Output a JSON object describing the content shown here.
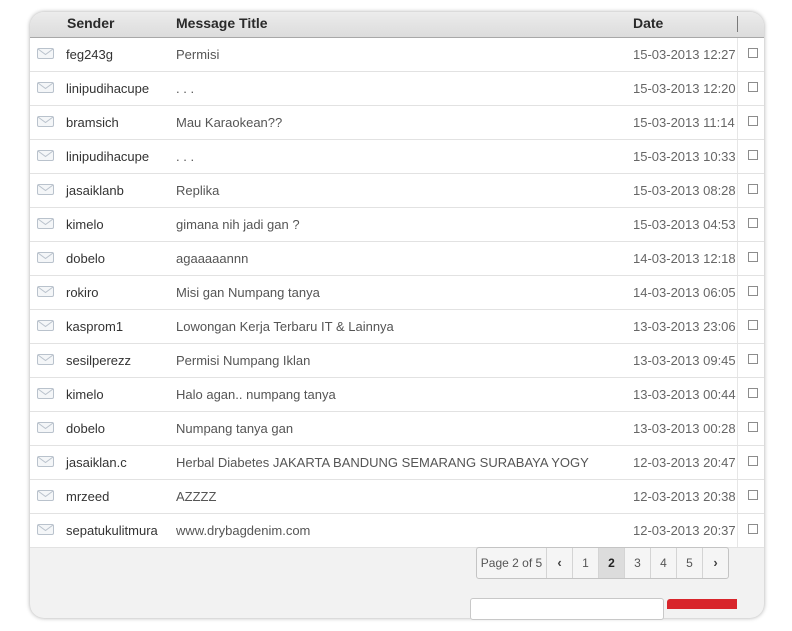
{
  "columns": {
    "sender": "Sender",
    "title": "Message Title",
    "date": "Date"
  },
  "messages": [
    {
      "sender": "feg243g",
      "title": "Permisi",
      "date": "15-03-2013 12:27"
    },
    {
      "sender": "linipudihacupe",
      "title": ". . .",
      "date": "15-03-2013 12:20"
    },
    {
      "sender": "bramsich",
      "title": "Mau Karaokean??",
      "date": "15-03-2013 11:14"
    },
    {
      "sender": "linipudihacupe",
      "title": ". . .",
      "date": "15-03-2013 10:33"
    },
    {
      "sender": "jasaiklanb",
      "title": "Replika",
      "date": "15-03-2013 08:28"
    },
    {
      "sender": "kimelo",
      "title": "gimana nih jadi gan ?",
      "date": "15-03-2013 04:53"
    },
    {
      "sender": "dobelo",
      "title": "agaaaaannn",
      "date": "14-03-2013 12:18"
    },
    {
      "sender": "rokiro",
      "title": "Misi gan Numpang tanya",
      "date": "14-03-2013 06:05"
    },
    {
      "sender": "kasprom1",
      "title": "Lowongan Kerja Terbaru IT & Lainnya",
      "date": "13-03-2013 23:06"
    },
    {
      "sender": "sesilperezz",
      "title": "Permisi Numpang Iklan",
      "date": "13-03-2013 09:45"
    },
    {
      "sender": "kimelo",
      "title": "Halo agan.. numpang tanya",
      "date": "13-03-2013 00:44"
    },
    {
      "sender": "dobelo",
      "title": "Numpang tanya gan",
      "date": "13-03-2013 00:28"
    },
    {
      "sender": "jasaiklan.c",
      "title": "Herbal Diabetes JAKARTA BANDUNG SEMARANG SURABAYA YOGY",
      "date": "12-03-2013 20:47"
    },
    {
      "sender": "mrzeed",
      "title": "AZZZZ",
      "date": "12-03-2013 20:38"
    },
    {
      "sender": "sepatukulitmura",
      "title": "www.drybagdenim.com",
      "date": "12-03-2013 20:37"
    }
  ],
  "pager": {
    "info": "Page 2 of 5",
    "prev_icon": "chevron-left-icon",
    "next_icon": "chevron-right-icon",
    "pages": [
      "1",
      "2",
      "3",
      "4",
      "5"
    ],
    "current_page": "2"
  },
  "colors": {
    "accent_red": "#d8252b",
    "header_bg": "#dcdcdc"
  },
  "row_icon": "envelope-icon"
}
